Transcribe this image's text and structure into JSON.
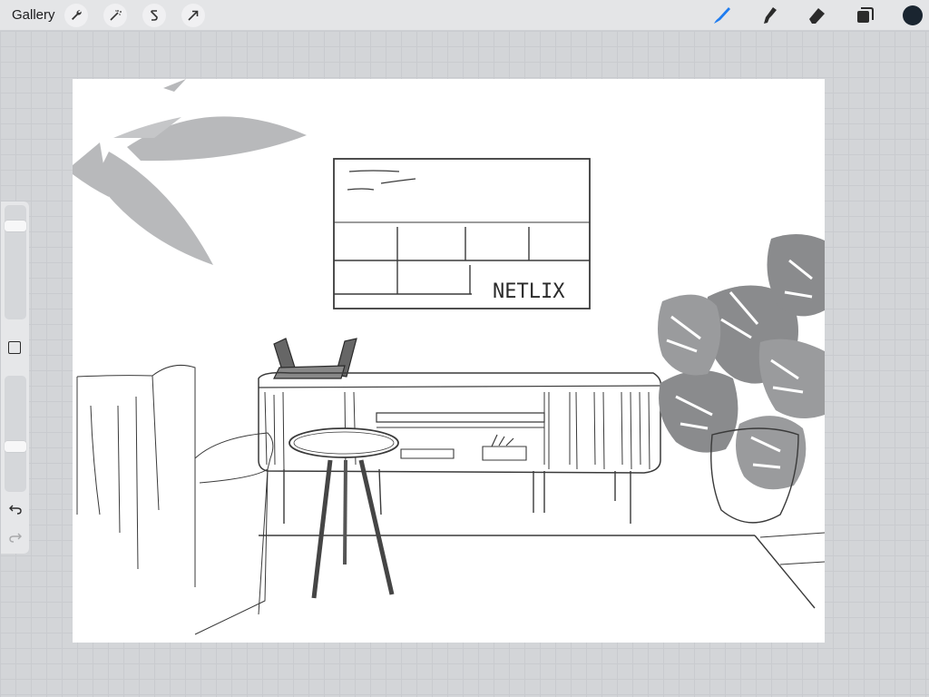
{
  "topbar": {
    "gallery_label": "Gallery",
    "left_tools": [
      "wrench-icon",
      "magic-wand-icon",
      "selection-icon",
      "transform-arrow-icon"
    ],
    "right_tools": [
      "brush-icon",
      "smudge-icon",
      "eraser-icon",
      "layers-icon"
    ],
    "active_tool": "brush-icon",
    "accent_color": "#1e7cf0",
    "current_color": "#1a2530"
  },
  "sidebar": {
    "brush_size_level": 0.15,
    "opacity_level": 0.62,
    "buttons": [
      "modify-button",
      "undo-icon",
      "redo-icon"
    ]
  },
  "canvas": {
    "background": "#ffffff",
    "tv_text": "NETLIX",
    "colors": {
      "leaf_light": "#b8b9bb",
      "leaf_dark": "#8a8b8d",
      "line": "#3a3a3a"
    }
  }
}
